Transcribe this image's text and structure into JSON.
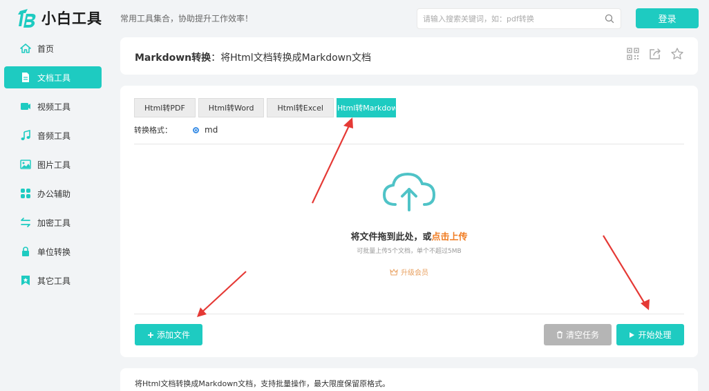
{
  "header": {
    "logo_text": "小白工具",
    "tagline": "常用工具集合，协助提升工作效率！",
    "search_placeholder": "请输入搜索关键词，如：pdf转换",
    "login_label": "登录"
  },
  "sidebar": {
    "items": [
      {
        "label": "首页",
        "icon": "home-icon"
      },
      {
        "label": "文档工具",
        "icon": "document-icon",
        "active": true
      },
      {
        "label": "视频工具",
        "icon": "video-icon"
      },
      {
        "label": "音频工具",
        "icon": "music-icon"
      },
      {
        "label": "图片工具",
        "icon": "image-icon"
      },
      {
        "label": "办公辅助",
        "icon": "apps-icon"
      },
      {
        "label": "加密工具",
        "icon": "swap-icon"
      },
      {
        "label": "单位转换",
        "icon": "lock-icon"
      },
      {
        "label": "其它工具",
        "icon": "bookmark-icon"
      }
    ]
  },
  "title_card": {
    "tool_name": "Markdown转换",
    "description": "：将Html文档转换成Markdown文档"
  },
  "tabs": [
    {
      "label": "Html转PDF"
    },
    {
      "label": "Html转Word"
    },
    {
      "label": "Html转Excel"
    },
    {
      "label": "Html转Markdown",
      "active": true
    }
  ],
  "format": {
    "label": "转换格式：",
    "option": "md"
  },
  "drop_zone": {
    "text": "将文件拖到此处，或",
    "link": "点击上传",
    "sub": "可批量上传5个文档，单个不超过5MB",
    "upgrade": "升级会员"
  },
  "buttons": {
    "add": "添加文件",
    "clear": "清空任务",
    "start": "开始处理"
  },
  "footer_text": "将Html文档转换成Markdown文档，支持批量操作，最大限度保留原格式。",
  "colors": {
    "accent": "#1ecbc1",
    "link": "#f07c22",
    "annotation": "#e53935"
  }
}
